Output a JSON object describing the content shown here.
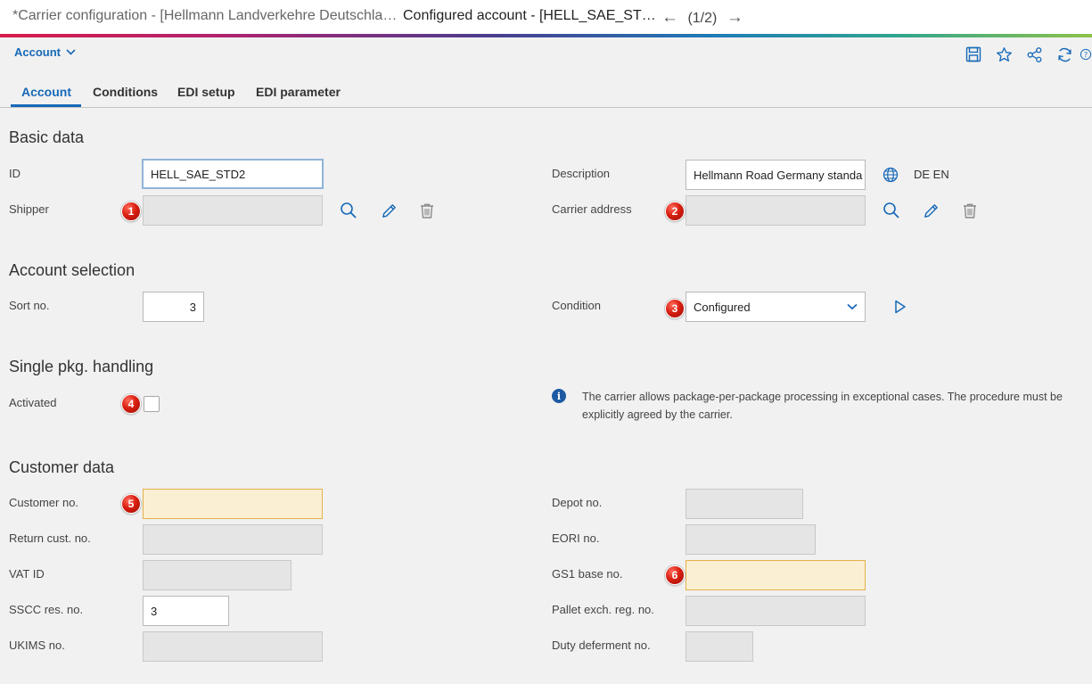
{
  "titlebar": {
    "inactive_tab": "*Carrier configuration - [Hellmann Landverkehre Deutschla…",
    "active_tab": "Configured account - [HELL_SAE_ST…",
    "back_arrow": "←",
    "record_position": "(1/2)",
    "forward_arrow": "→"
  },
  "toolbar": {
    "account_menu": "Account",
    "icons": [
      "save-icon",
      "star-icon",
      "share-icon",
      "refresh-icon",
      "help-icon"
    ]
  },
  "tabs": [
    {
      "label": "Account",
      "active": true
    },
    {
      "label": "Conditions",
      "active": false
    },
    {
      "label": "EDI setup",
      "active": false
    },
    {
      "label": "EDI parameter",
      "active": false
    }
  ],
  "basic_data": {
    "title": "Basic data",
    "id_label": "ID",
    "id_value": "HELL_SAE_STD2",
    "shipper_label": "Shipper",
    "shipper_value": "",
    "description_label": "Description",
    "description_value": "Hellmann Road Germany standa",
    "languages": "DE EN",
    "carrier_address_label": "Carrier address",
    "carrier_address_value": ""
  },
  "account_selection": {
    "title": "Account selection",
    "sort_no_label": "Sort no.",
    "sort_no_value": "3",
    "condition_label": "Condition",
    "condition_value": "Configured"
  },
  "single_pkg": {
    "title": "Single pkg. handling",
    "activated_label": "Activated",
    "activated": false,
    "info_text": "The carrier allows package-per-package processing in exceptional cases. The procedure must be explicitly agreed by the carrier."
  },
  "customer_data": {
    "title": "Customer data",
    "customer_no_label": "Customer no.",
    "return_cust_no_label": "Return cust. no.",
    "vat_id_label": "VAT ID",
    "sscc_res_no_label": "SSCC res. no.",
    "sscc_res_no_value": "3",
    "ukims_no_label": "UKIMS no.",
    "depot_no_label": "Depot no.",
    "eori_no_label": "EORI no.",
    "gs1_base_no_label": "GS1 base no.",
    "pallet_exch_label": "Pallet exch. reg. no.",
    "duty_deferment_label": "Duty deferment no."
  },
  "badges": [
    "1",
    "2",
    "3",
    "4",
    "5",
    "6"
  ],
  "colors": {
    "accent": "#1769b8",
    "required_field": "#faefd2",
    "badge": "#d91f11",
    "info": "#1d5aa3"
  }
}
